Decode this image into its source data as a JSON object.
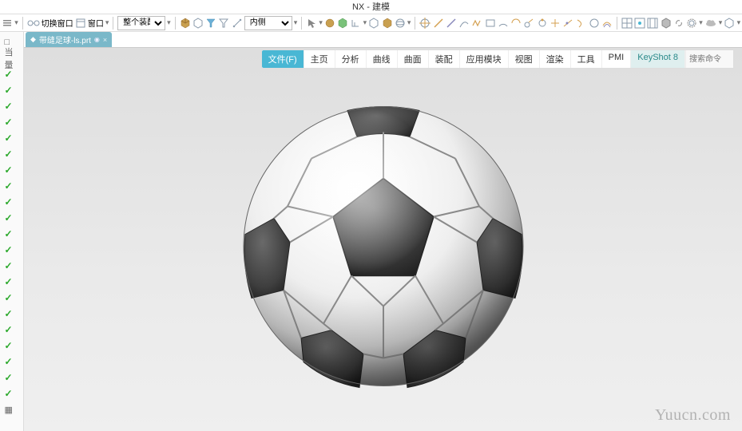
{
  "title": "NX - 建模",
  "toolbar": {
    "switch_window_label": "切换窗口",
    "window_label": "窗口",
    "assembly_dropdown": "整个装配",
    "interior_dropdown": "内侧"
  },
  "file_tab": {
    "name": "带缝足球-ls.prt",
    "pinned_indicator": "◉",
    "close": "×"
  },
  "ribbon": {
    "tabs": [
      "文件(F)",
      "主页",
      "分析",
      "曲线",
      "曲面",
      "装配",
      "应用模块",
      "视图",
      "渲染",
      "工具",
      "PMI",
      "KeyShot 8"
    ],
    "active_index": 0,
    "search_placeholder": "搜索命令"
  },
  "left_panel": {
    "header_icons": [
      "□",
      "◫",
      "量"
    ],
    "items_checked": 21,
    "bottom_icon": "▦"
  },
  "watermark": "Yuucn.com",
  "colors": {
    "accent": "#49b7d4",
    "tab_bg": "#7ab8c9",
    "check": "#2aa82a"
  }
}
